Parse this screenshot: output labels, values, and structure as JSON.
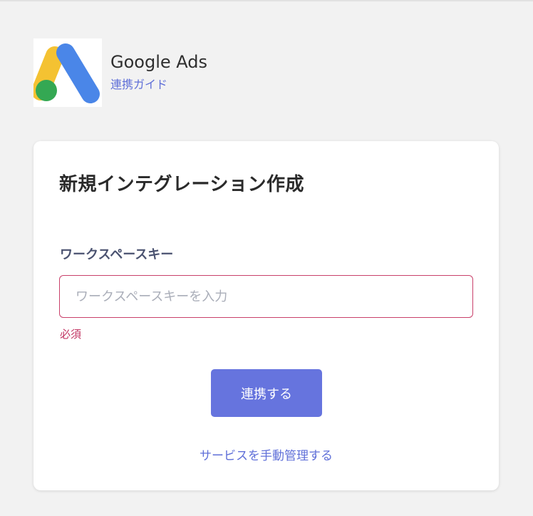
{
  "service": {
    "name": "Google Ads",
    "guide_link": "連携ガイド",
    "logo_icon": "google-ads-logo"
  },
  "form": {
    "title": "新規インテグレーション作成",
    "field_label": "ワークスペースキー",
    "input_placeholder": "ワークスペースキーを入力",
    "input_value": "",
    "required_message": "必須",
    "submit_label": "連携する",
    "manual_link": "サービスを手動管理する"
  },
  "colors": {
    "accent": "#6674de",
    "link": "#5f6fd8",
    "error": "#c23563",
    "logo_blue": "#4a86e8",
    "logo_yellow": "#f4c232",
    "logo_green": "#34a853"
  }
}
